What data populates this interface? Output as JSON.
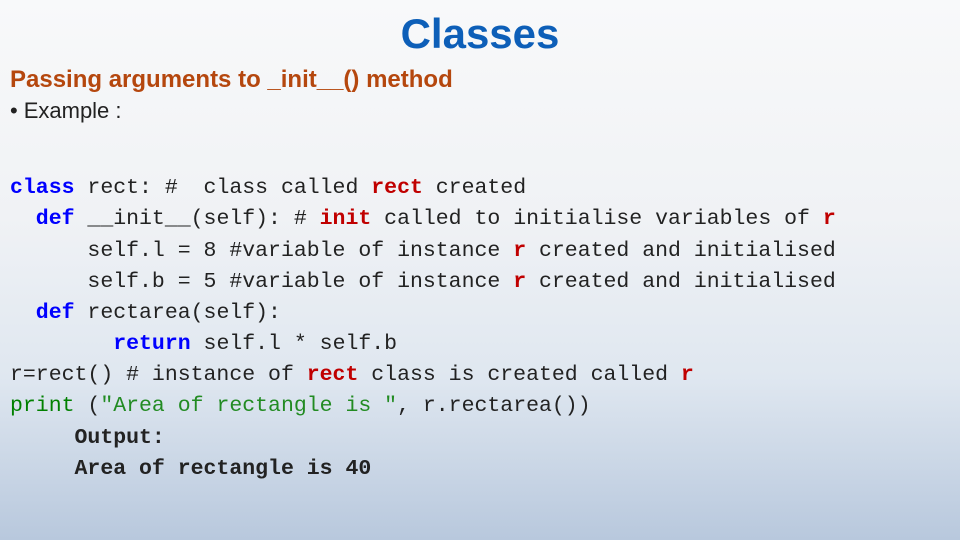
{
  "title": "Classes",
  "subtitle": "Passing arguments to _init__() method",
  "bullet": "Example :",
  "code": {
    "l1_a": "class",
    "l1_b": " rect: #  class called ",
    "l1_c": "rect",
    "l1_d": " created",
    "l2_a": "  def",
    "l2_b": " __init__(self): # ",
    "l2_c": "init",
    "l2_d": " called to initialise variables of ",
    "l2_e": "r",
    "l3_a": "      self.l = 8 #variable of instance ",
    "l3_b": "r",
    "l3_c": " created and initialised",
    "l4_a": "      self.b = 5 #variable of instance ",
    "l4_b": "r",
    "l4_c": " created and initialised",
    "l5_a": "  def ",
    "l5_b": "rectarea(self):",
    "l6_a": "        return",
    "l6_b": " self.l * self.b",
    "l7_a": "r=rect() # instance of ",
    "l7_b": "rect",
    "l7_c": " class is created called ",
    "l7_d": "r",
    "l8_a": "print",
    "l8_b": " (",
    "l8_c": "\"Area of rectangle is \"",
    "l8_d": ", r.rectarea())",
    "l9": "     Output:",
    "l10": "     Area of rectangle is 40"
  }
}
